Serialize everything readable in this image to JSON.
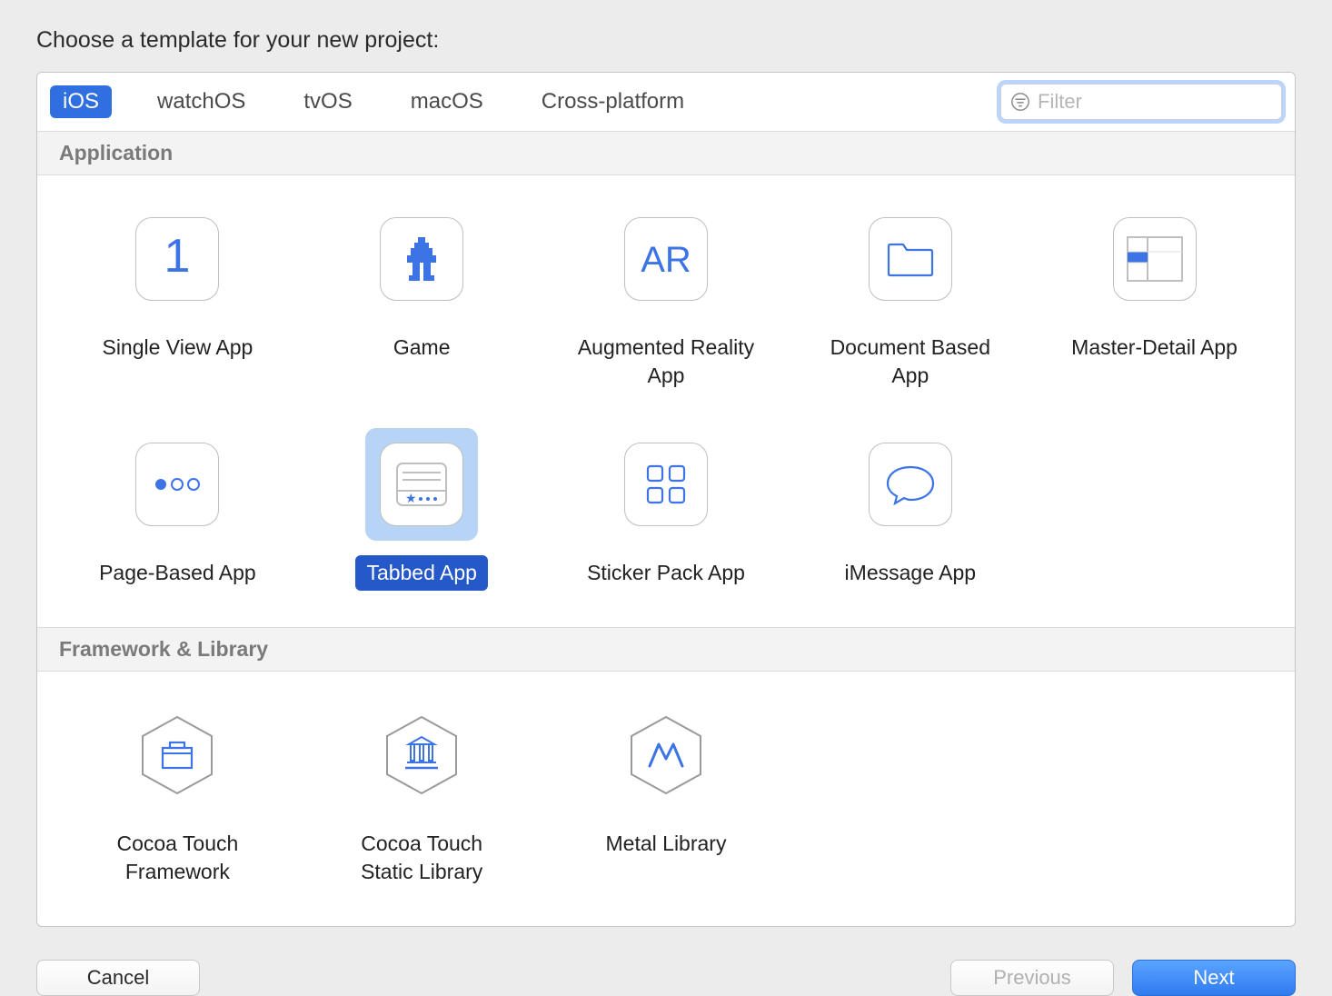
{
  "title": "Choose a template for your new project:",
  "platforms": {
    "items": [
      "iOS",
      "watchOS",
      "tvOS",
      "macOS",
      "Cross-platform"
    ],
    "active_index": 0
  },
  "filter": {
    "placeholder": "Filter",
    "value": ""
  },
  "sections": [
    {
      "title": "Application",
      "templates": [
        {
          "label": "Single View App",
          "icon": "single-view-icon",
          "selected": false
        },
        {
          "label": "Game",
          "icon": "game-icon",
          "selected": false
        },
        {
          "label": "Augmented Reality App",
          "icon": "ar-icon",
          "selected": false
        },
        {
          "label": "Document Based App",
          "icon": "document-icon",
          "selected": false
        },
        {
          "label": "Master-Detail App",
          "icon": "master-detail-icon",
          "selected": false
        },
        {
          "label": "Page-Based App",
          "icon": "page-based-icon",
          "selected": false
        },
        {
          "label": "Tabbed App",
          "icon": "tabbed-icon",
          "selected": true
        },
        {
          "label": "Sticker Pack App",
          "icon": "sticker-pack-icon",
          "selected": false
        },
        {
          "label": "iMessage App",
          "icon": "imessage-icon",
          "selected": false
        }
      ]
    },
    {
      "title": "Framework & Library",
      "templates": [
        {
          "label": "Cocoa Touch Framework",
          "icon": "framework-icon",
          "selected": false
        },
        {
          "label": "Cocoa Touch Static Library",
          "icon": "static-library-icon",
          "selected": false
        },
        {
          "label": "Metal Library",
          "icon": "metal-library-icon",
          "selected": false
        }
      ]
    }
  ],
  "buttons": {
    "cancel": "Cancel",
    "previous": "Previous",
    "next": "Next"
  },
  "colors": {
    "accent": "#2f6fe0",
    "icon_blue": "#3c74e6"
  }
}
